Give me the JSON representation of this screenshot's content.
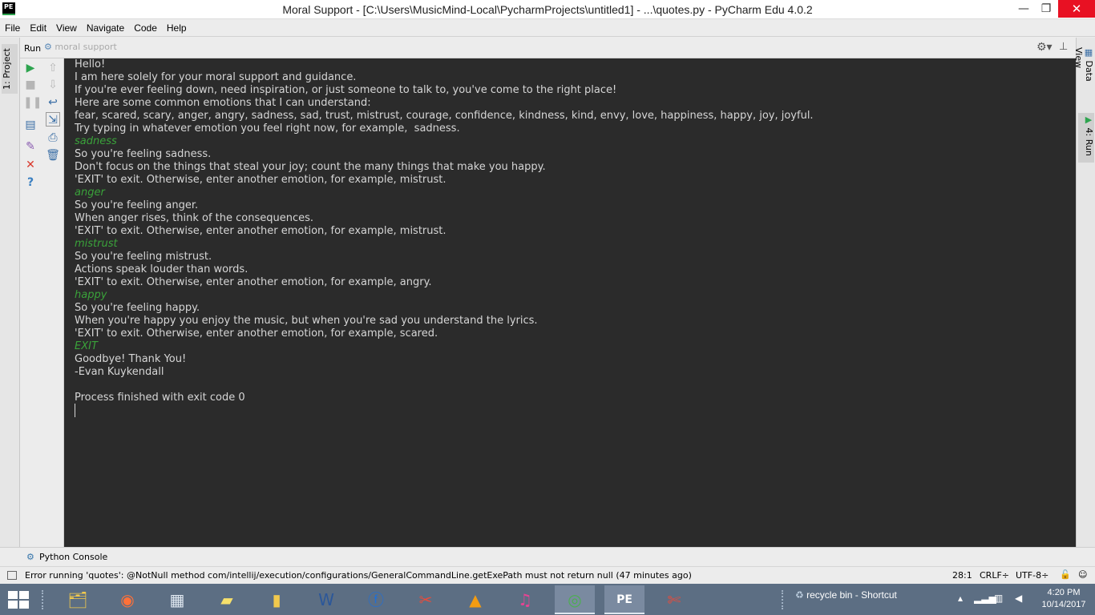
{
  "window": {
    "title": "Moral Support - [C:\\Users\\MusicMind-Local\\PycharmProjects\\untitled1] - ...\\quotes.py - PyCharm Edu 4.0.2",
    "app_icon_text": "PE",
    "minimize": "—",
    "maximize": "❐",
    "close": "✕"
  },
  "menu": [
    "File",
    "Edit",
    "View",
    "Navigate",
    "Code",
    "Help"
  ],
  "left_tabs": {
    "project": "1: Project"
  },
  "right_tabs": {
    "data_view": "Data View",
    "run": "4: Run"
  },
  "run_panel": {
    "label": "Run",
    "config_name": "moral support"
  },
  "console": {
    "lines": [
      {
        "text": "Hello!",
        "input": false
      },
      {
        "text": "I am here solely for your moral support and guidance.",
        "input": false
      },
      {
        "text": "If you're ever feeling down, need inspiration, or just someone to talk to, you've come to the right place!",
        "input": false
      },
      {
        "text": "Here are some common emotions that I can understand:",
        "input": false
      },
      {
        "text": "fear, scared, scary, anger, angry, sadness, sad, trust, mistrust, courage, confidence, kindness, kind, envy, love, happiness, happy, joy, joyful.",
        "input": false
      },
      {
        "text": "Try typing in whatever emotion you feel right now, for example,  sadness.",
        "input": false
      },
      {
        "text": "sadness",
        "input": true
      },
      {
        "text": "So you're feeling sadness.",
        "input": false
      },
      {
        "text": "Don't focus on the things that steal your joy; count the many things that make you happy.",
        "input": false
      },
      {
        "text": "'EXIT' to exit. Otherwise, enter another emotion, for example, mistrust.",
        "input": false
      },
      {
        "text": "anger",
        "input": true
      },
      {
        "text": "So you're feeling anger.",
        "input": false
      },
      {
        "text": "When anger rises, think of the consequences.",
        "input": false
      },
      {
        "text": "'EXIT' to exit. Otherwise, enter another emotion, for example, mistrust.",
        "input": false
      },
      {
        "text": "mistrust",
        "input": true
      },
      {
        "text": "So you're feeling mistrust.",
        "input": false
      },
      {
        "text": "Actions speak louder than words.",
        "input": false
      },
      {
        "text": "'EXIT' to exit. Otherwise, enter another emotion, for example, angry.",
        "input": false
      },
      {
        "text": "happy",
        "input": true
      },
      {
        "text": "So you're feeling happy.",
        "input": false
      },
      {
        "text": "When you're happy you enjoy the music, but when you're sad you understand the lyrics.",
        "input": false
      },
      {
        "text": "'EXIT' to exit. Otherwise, enter another emotion, for example, scared.",
        "input": false
      },
      {
        "text": "EXIT",
        "input": true
      },
      {
        "text": "Goodbye! Thank You!",
        "input": false
      },
      {
        "text": "-Evan Kuykendall",
        "input": false
      },
      {
        "text": "",
        "input": false
      },
      {
        "text": "Process finished with exit code 0",
        "input": false
      }
    ]
  },
  "bottom_tools": {
    "python_console": "Python Console"
  },
  "status": {
    "message": "Error running 'quotes': @NotNull method com/intellij/execution/configurations/GeneralCommandLine.getExePath must not return null (47 minutes ago)",
    "position": "28:1",
    "line_separator": "CRLF÷",
    "encoding": "UTF-8÷"
  },
  "taskbar": {
    "recycle_bin": "recycle bin - Shortcut",
    "time": "4:20 PM",
    "date": "10/14/2017"
  },
  "colors": {
    "console_bg": "#2b2b2b",
    "console_text": "#d6d6d6",
    "console_input": "#3aa23a",
    "taskbar_bg": "#5c6e83",
    "close_button": "#e81123"
  }
}
